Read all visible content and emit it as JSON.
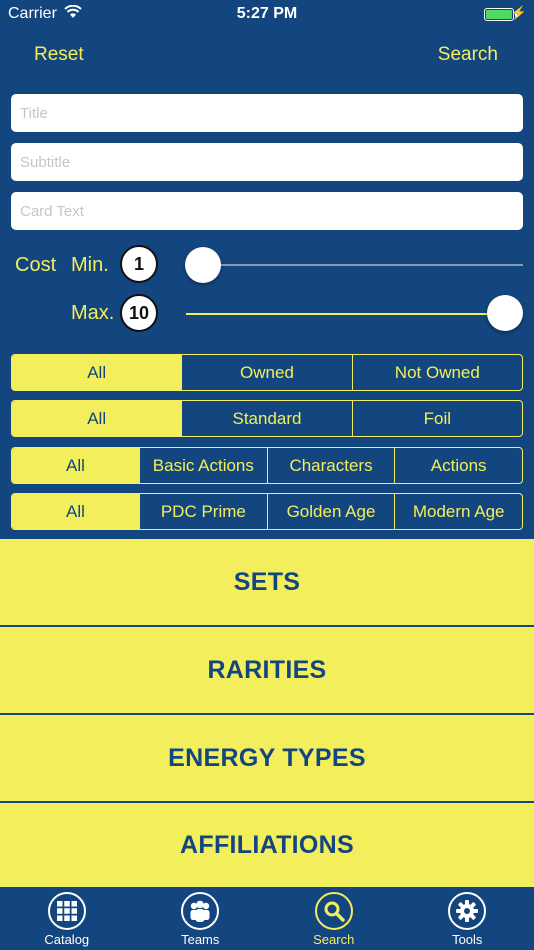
{
  "status_bar": {
    "carrier": "Carrier",
    "time": "5:27 PM",
    "battery_level": 1.0
  },
  "nav": {
    "reset_label": "Reset",
    "search_label": "Search"
  },
  "fields": {
    "title_placeholder": "Title",
    "subtitle_placeholder": "Subtitle",
    "card_text_placeholder": "Card Text"
  },
  "cost": {
    "label": "Cost",
    "min_label": "Min.",
    "max_label": "Max.",
    "min_value": "1",
    "max_value": "10"
  },
  "filters": {
    "ownership": [
      "All",
      "Owned",
      "Not Owned"
    ],
    "finish": [
      "All",
      "Standard",
      "Foil"
    ],
    "card_type": [
      "All",
      "Basic Actions",
      "Characters",
      "Actions"
    ],
    "era": [
      "All",
      "PDC Prime",
      "Golden Age",
      "Modern Age"
    ]
  },
  "panels": {
    "sets": "SETS",
    "rarities": "RARITIES",
    "energy_types": "ENERGY TYPES",
    "affiliations": "AFFILIATIONS"
  },
  "tabs": {
    "catalog": "Catalog",
    "teams": "Teams",
    "search": "Search",
    "tools": "Tools"
  },
  "colors": {
    "background": "#13467f",
    "accent": "#f3ee5c",
    "battery": "#4cd964"
  }
}
